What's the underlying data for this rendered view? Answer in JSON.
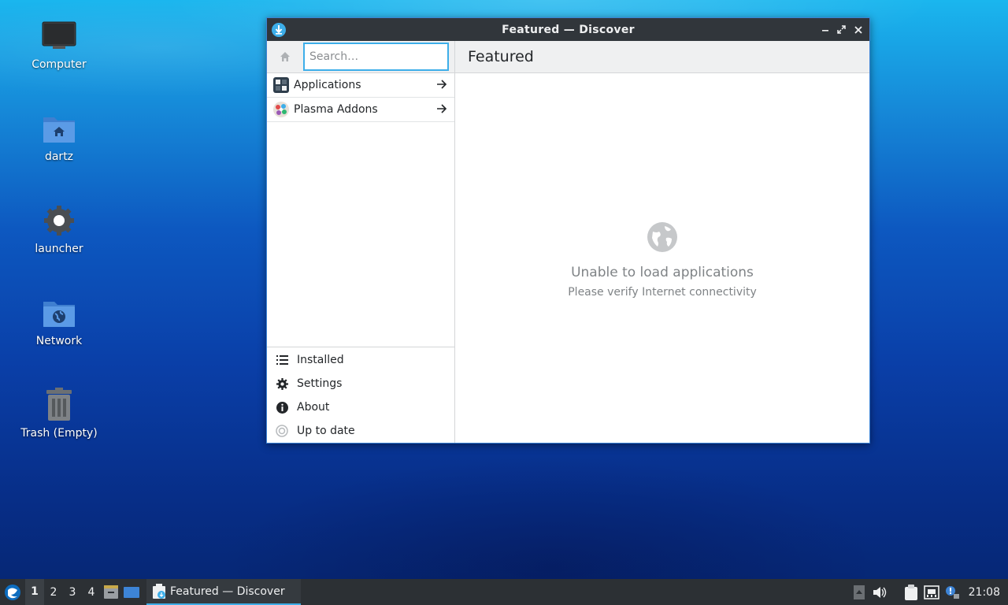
{
  "desktop": {
    "icons": [
      {
        "label": "Computer",
        "icon": "monitor-icon"
      },
      {
        "label": "dartz",
        "icon": "home-folder-icon"
      },
      {
        "label": "launcher",
        "icon": "gear-icon"
      },
      {
        "label": "Network",
        "icon": "network-folder-icon"
      },
      {
        "label": "Trash (Empty)",
        "icon": "trash-icon"
      }
    ]
  },
  "window": {
    "title": "Featured — Discover",
    "search_placeholder": "Search…",
    "categories": [
      {
        "label": "Applications",
        "icon": "applications-icon"
      },
      {
        "label": "Plasma Addons",
        "icon": "plasma-addons-icon"
      }
    ],
    "actions": [
      {
        "label": "Installed",
        "icon": "list-icon"
      },
      {
        "label": "Settings",
        "icon": "gear-icon"
      },
      {
        "label": "About",
        "icon": "info-icon"
      },
      {
        "label": "Up to date",
        "icon": "update-icon"
      }
    ],
    "page_title": "Featured",
    "empty_message": "Unable to load applications",
    "empty_sub": "Please verify Internet connectivity"
  },
  "taskbar": {
    "desktops": [
      "1",
      "2",
      "3",
      "4"
    ],
    "active_task": "Featured — Discover",
    "clock": "21:08"
  },
  "colors": {
    "accent": "#3daee9",
    "titlebar": "#31363b",
    "taskbar": "#2c3034"
  }
}
